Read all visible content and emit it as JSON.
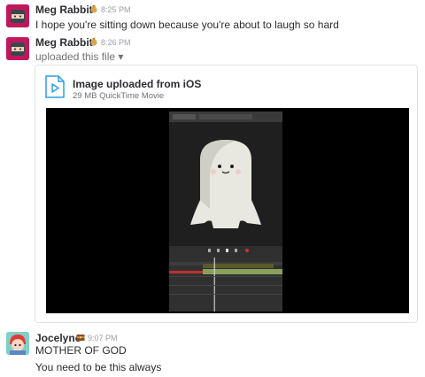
{
  "messages": [
    {
      "author": "Meg Rabbit",
      "time": "8:25 PM",
      "text": "I hope you're sitting down because you're about to laugh so hard"
    },
    {
      "author": "Meg Rabbit",
      "time": "8:26 PM",
      "subtitle": "uploaded this file ▾",
      "file": {
        "title": "Image uploaded from iOS",
        "meta": "29 MB QuickTime Movie"
      }
    },
    {
      "author": "Jocelyne",
      "time": "9:07 PM",
      "lines": [
        "MOTHER OF GOD",
        "You need to be this always"
      ]
    }
  ],
  "colors": {
    "meg_avatar": "#c2185b",
    "jocelyne_avatar": "#7fd1c8",
    "file_icon": "#2d9ee0"
  },
  "icons": {
    "file": "video-file-icon",
    "meg_emoji": "money-bag-icon",
    "jocelyne_emoji": "treasure-chest-icon"
  },
  "video": {
    "playhead_progress": 0.4
  }
}
